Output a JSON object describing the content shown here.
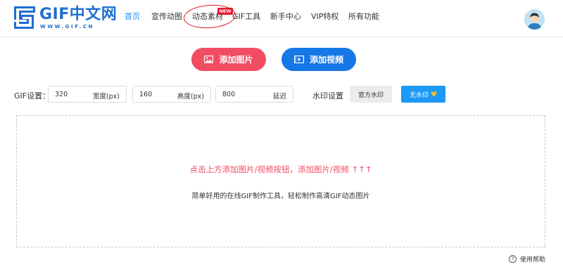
{
  "logo": {
    "title": "GIF中文网",
    "subtitle": "WWW.GIF.CN",
    "color": "#1f6fd0"
  },
  "nav": {
    "items": [
      {
        "label": "首页",
        "active": true
      },
      {
        "label": "宣传动图"
      },
      {
        "label": "动态素材",
        "badge": "NEW"
      },
      {
        "label": "GIF工具"
      },
      {
        "label": "新手中心"
      },
      {
        "label": "VIP特权"
      },
      {
        "label": "所有功能"
      }
    ],
    "active_color": "#1a90ff"
  },
  "actions": {
    "add_image": "添加图片",
    "add_video": "添加视频",
    "image_color": "#f24c63",
    "video_color": "#1677e6"
  },
  "settings": {
    "label": "GIF设置：",
    "width": {
      "value": "320",
      "unit": "宽度(px)"
    },
    "height": {
      "value": "160",
      "unit": "高度(px)"
    },
    "delay": {
      "value": "800",
      "unit": "延迟"
    },
    "watermark_label": "水印设置",
    "watermark_official": "官方水印",
    "watermark_none": "无水印",
    "watermark_none_icon": "diamond-icon"
  },
  "dropzone": {
    "hint": "点击上方添加图片/视频按钮，添加图片/视频 ↑↑↑",
    "description": "简单好用的在线GIF制作工具，轻松制作高清GIF动态图片"
  },
  "help": {
    "label": "使用帮助",
    "icon": "help-icon"
  }
}
